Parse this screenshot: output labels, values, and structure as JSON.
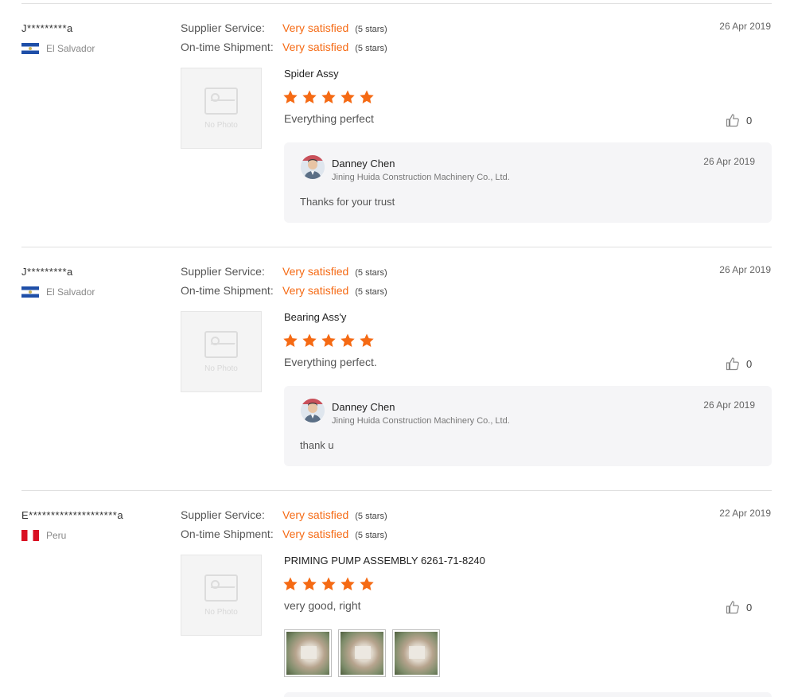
{
  "labels": {
    "supplier_service": "Supplier Service:",
    "ontime_shipment": "On-time Shipment:",
    "no_photo": "No Photo"
  },
  "colors": {
    "accent": "#f56a14",
    "reply_bg": "#f5f5f7"
  },
  "reviews": [
    {
      "buyer": "J*********a",
      "country": "El Salvador",
      "country_flag": "el-salvador-flag",
      "date": "26 Apr 2019",
      "supplier_service": {
        "value": "Very satisfied",
        "stars": "(5 stars)"
      },
      "ontime_shipment": {
        "value": "Very satisfied",
        "stars": "(5 stars)"
      },
      "product": "Spider Assy",
      "rating": 5,
      "text": "Everything perfect",
      "likes": "0",
      "reply": {
        "name": "Danney Chen",
        "company": "Jining Huida Construction Machinery Co., Ltd.",
        "date": "26 Apr 2019",
        "text": "Thanks for your trust"
      }
    },
    {
      "buyer": "J*********a",
      "country": "El Salvador",
      "country_flag": "el-salvador-flag",
      "date": "26 Apr 2019",
      "supplier_service": {
        "value": "Very satisfied",
        "stars": "(5 stars)"
      },
      "ontime_shipment": {
        "value": "Very satisfied",
        "stars": "(5 stars)"
      },
      "product": "Bearing Ass'y",
      "rating": 5,
      "text": "Everything perfect.",
      "likes": "0",
      "reply": {
        "name": "Danney Chen",
        "company": "Jining Huida Construction Machinery Co., Ltd.",
        "date": "26 Apr 2019",
        "text": "thank u"
      }
    },
    {
      "buyer": "E********************a",
      "country": "Peru",
      "country_flag": "peru-flag",
      "date": "22 Apr 2019",
      "supplier_service": {
        "value": "Very satisfied",
        "stars": "(5 stars)"
      },
      "ontime_shipment": {
        "value": "Very satisfied",
        "stars": "(5 stars)"
      },
      "product": "PRIMING PUMP ASSEMBLY 6261-71-8240",
      "rating": 5,
      "text": "very good, right",
      "likes": "0",
      "photo_count": 3
    }
  ]
}
